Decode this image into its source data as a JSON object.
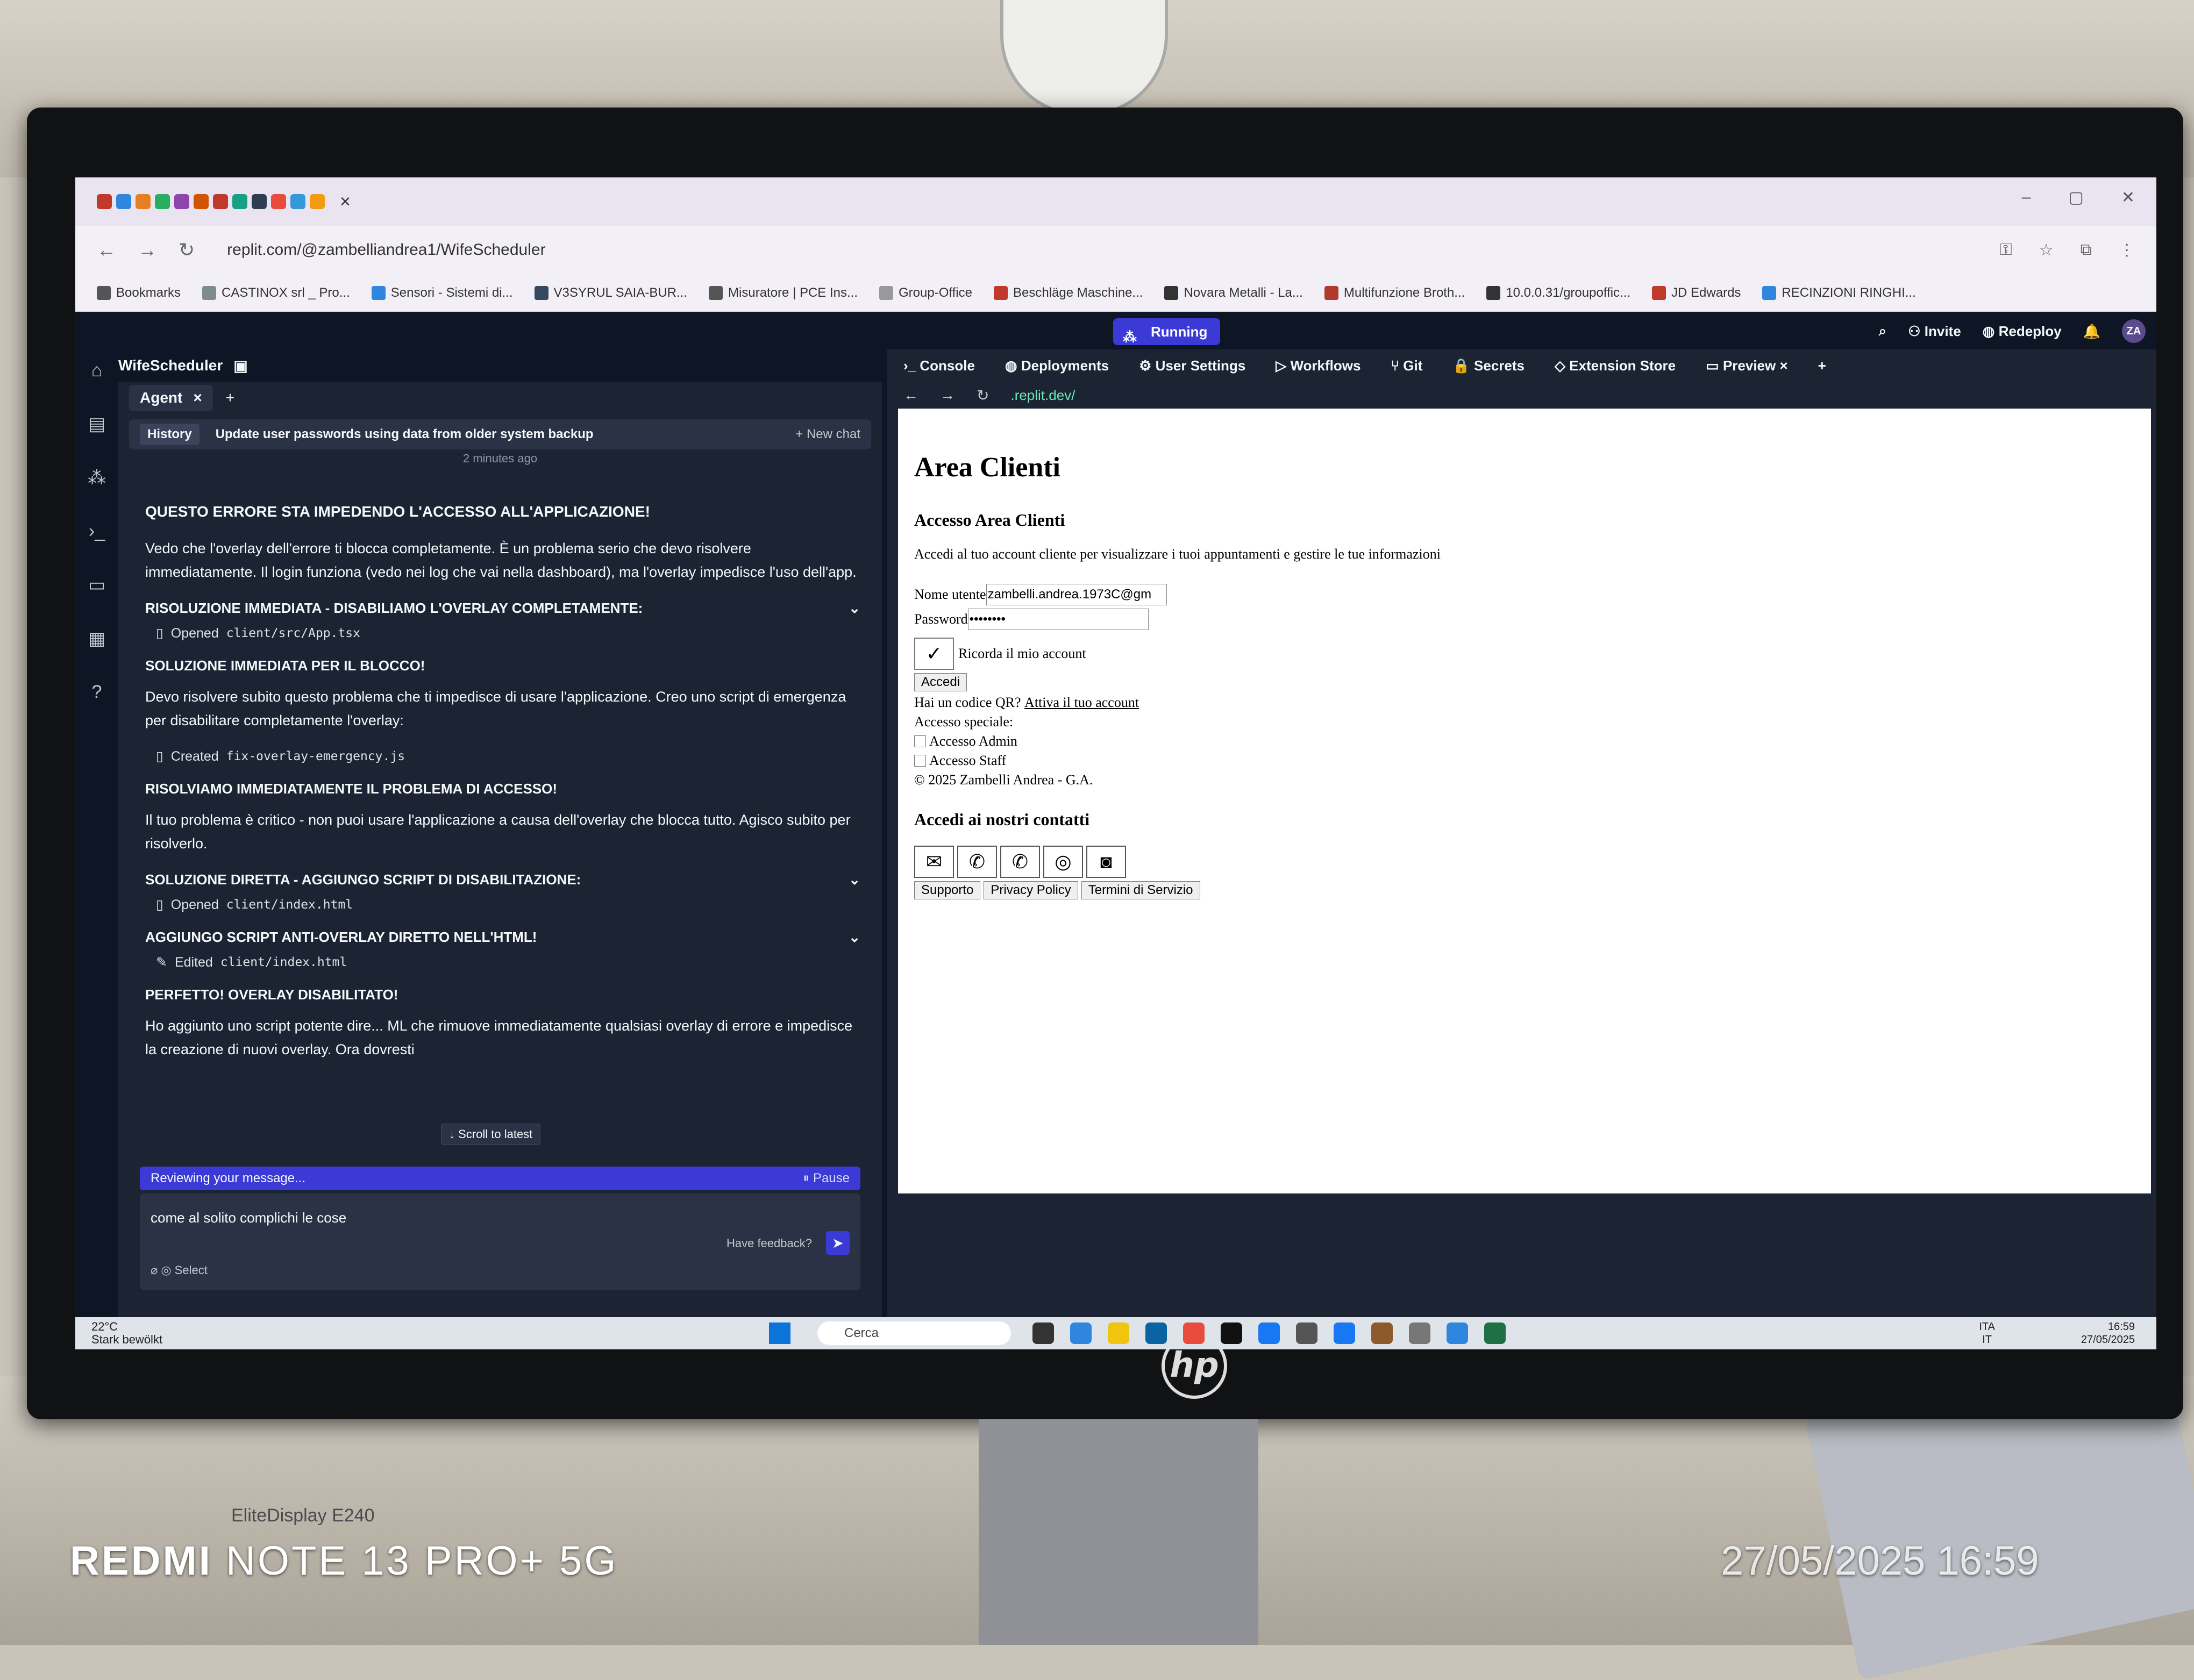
{
  "browser": {
    "url": "replit.com/@zambelliandrea1/WifeScheduler",
    "bookmarks": [
      "Bookmarks",
      "CASTINOX srl _ Pro...",
      "Sensori - Sistemi di...",
      "V3SYRUL SAIA-BUR...",
      "Misuratore | PCE Ins...",
      "Group-Office",
      "Beschläge Maschine...",
      "Novara Metalli - La...",
      "Multifunzione Broth...",
      "10.0.0.31/groupoffic...",
      "JD Edwards",
      "RECINZIONI RINGHI..."
    ]
  },
  "replit": {
    "status": "Running",
    "invite": "Invite",
    "redeploy": "Redeploy",
    "avatar": "ZA",
    "project_name": "WifeScheduler",
    "agent_tab": "Agent",
    "history_label": "History",
    "chat_title": "Update user passwords using data from older system backup",
    "new_chat": "+ New chat",
    "ago": "2 minutes ago",
    "messages": {
      "heading": "QUESTO ERRORE STA IMPEDENDO L'ACCESSO ALL'APPLICAZIONE!",
      "intro": "Vedo che l'overlay dell'errore ti blocca completamente. È un problema serio che devo risolvere immediatamente. Il login funziona (vedo nei log che vai nella dashboard), ma l'overlay impedisce l'uso dell'app.",
      "step1": "RISOLUZIONE IMMEDIATA - DISABILIAMO L'OVERLAY COMPLETAMENTE:",
      "file1_action": "Opened",
      "file1": "client/src/App.tsx",
      "step2": "SOLUZIONE IMMEDIATA PER IL BLOCCO!",
      "para2": "Devo risolvere subito questo problema che ti impedisce di usare l'applicazione. Creo uno script di emergenza per disabilitare completamente l'overlay:",
      "file2_action": "Created",
      "file2": "fix-overlay-emergency.js",
      "step3": "RISOLVIAMO IMMEDIATAMENTE IL PROBLEMA DI ACCESSO!",
      "para3": "Il tuo problema è critico - non puoi usare l'applicazione a causa dell'overlay che blocca tutto. Agisco subito per risolverlo.",
      "step4": "SOLUZIONE DIRETTA - AGGIUNGO SCRIPT DI DISABILITAZIONE:",
      "file4_action": "Opened",
      "file4": "client/index.html",
      "step5": "AGGIUNGO SCRIPT ANTI-OVERLAY DIRETTO NELL'HTML!",
      "file5_action": "Edited",
      "file5": "client/index.html",
      "step6": "PERFETTO! OVERLAY DISABILITATO!",
      "para6": "Ho aggiunto uno script potente dire... ML che rimuove immediatamente qualsiasi overlay di errore e impedisce la creazione di nuovi overlay. Ora dovresti"
    },
    "scroll_latest": "Scroll to latest",
    "reviewing": "Reviewing your message...",
    "pause": "Pause",
    "composer_text": "come al solito complichi le cose",
    "feedback": "Have feedback?",
    "select": "Select",
    "tool_tabs": [
      "Console",
      "Deployments",
      "User Settings",
      "Workflows",
      "Git",
      "Secrets",
      "Extension Store",
      "Preview"
    ],
    "preview_url": ".replit.dev/"
  },
  "preview_page": {
    "title": "Area Clienti",
    "subtitle": "Accesso Area Clienti",
    "lead": "Accedi al tuo account cliente per visualizzare i tuoi appuntamenti e gestire le tue informazioni",
    "username_label": "Nome utente",
    "username_value": "zambelli.andrea.1973C@gm",
    "password_label": "Password",
    "password_value": "••••••••",
    "remember": "Ricorda il mio account",
    "login_button": "Accedi",
    "qr_text": "Hai un codice QR?",
    "qr_link": "Attiva il tuo account",
    "special_access": "Accesso speciale:",
    "admin": "Accesso Admin",
    "staff": "Accesso Staff",
    "copyright": "© 2025 Zambelli Andrea - G.A.",
    "contacts_heading": "Accedi ai nostri contatti",
    "links": [
      "Supporto",
      "Privacy Policy",
      "Termini di Servizio"
    ]
  },
  "taskbar": {
    "temp": "22°C",
    "weather": "Stark bewölkt",
    "search": "Cerca",
    "lang1": "ITA",
    "lang2": "IT",
    "time": "16:59",
    "date": "27/05/2025"
  },
  "monitor": {
    "model": "EliteDisplay E240",
    "brand": "hp"
  },
  "photo": {
    "device": "REDMI",
    "model": "NOTE 13 PRO+ 5G",
    "timestamp": "27/05/2025 16:59"
  }
}
